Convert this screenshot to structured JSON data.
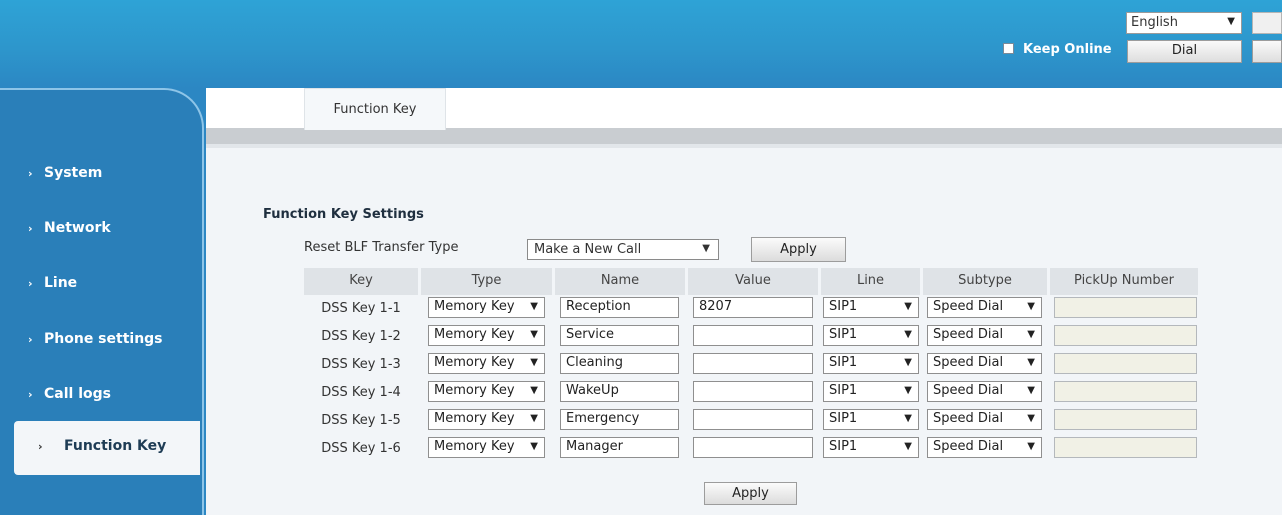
{
  "header": {
    "language": "English",
    "keep_online_label": "Keep Online",
    "dial_label": "Dial"
  },
  "sidebar": {
    "items": [
      {
        "label": "System"
      },
      {
        "label": "Network"
      },
      {
        "label": "Line"
      },
      {
        "label": "Phone settings"
      },
      {
        "label": "Call logs"
      },
      {
        "label": "Function Key",
        "active": true
      }
    ]
  },
  "tabs": [
    {
      "label": "Function Key",
      "active": true
    }
  ],
  "main": {
    "section_title": "Function Key Settings",
    "reset_blf": {
      "label": "Reset BLF Transfer Type",
      "value": "Make a New Call"
    },
    "apply_label": "Apply",
    "table": {
      "columns": [
        "Key",
        "Type",
        "Name",
        "Value",
        "Line",
        "Subtype",
        "PickUp Number"
      ],
      "rows": [
        {
          "key": "DSS Key 1-1",
          "type": "Memory Key",
          "name": "Reception",
          "value": "8207",
          "line": "SIP1",
          "subtype": "Speed Dial",
          "pickup": ""
        },
        {
          "key": "DSS Key 1-2",
          "type": "Memory Key",
          "name": "Service",
          "value": "",
          "line": "SIP1",
          "subtype": "Speed Dial",
          "pickup": ""
        },
        {
          "key": "DSS Key 1-3",
          "type": "Memory Key",
          "name": "Cleaning",
          "value": "",
          "line": "SIP1",
          "subtype": "Speed Dial",
          "pickup": ""
        },
        {
          "key": "DSS Key 1-4",
          "type": "Memory Key",
          "name": "WakeUp",
          "value": "",
          "line": "SIP1",
          "subtype": "Speed Dial",
          "pickup": ""
        },
        {
          "key": "DSS Key 1-5",
          "type": "Memory Key",
          "name": "Emergency",
          "value": "",
          "line": "SIP1",
          "subtype": "Speed Dial",
          "pickup": ""
        },
        {
          "key": "DSS Key 1-6",
          "type": "Memory Key",
          "name": "Manager",
          "value": "",
          "line": "SIP1",
          "subtype": "Speed Dial",
          "pickup": ""
        }
      ]
    }
  },
  "colors": {
    "header_blue": "#2e9fd4",
    "sidebar_blue": "#2a7fb9",
    "content_bg": "#f2f5f8"
  }
}
